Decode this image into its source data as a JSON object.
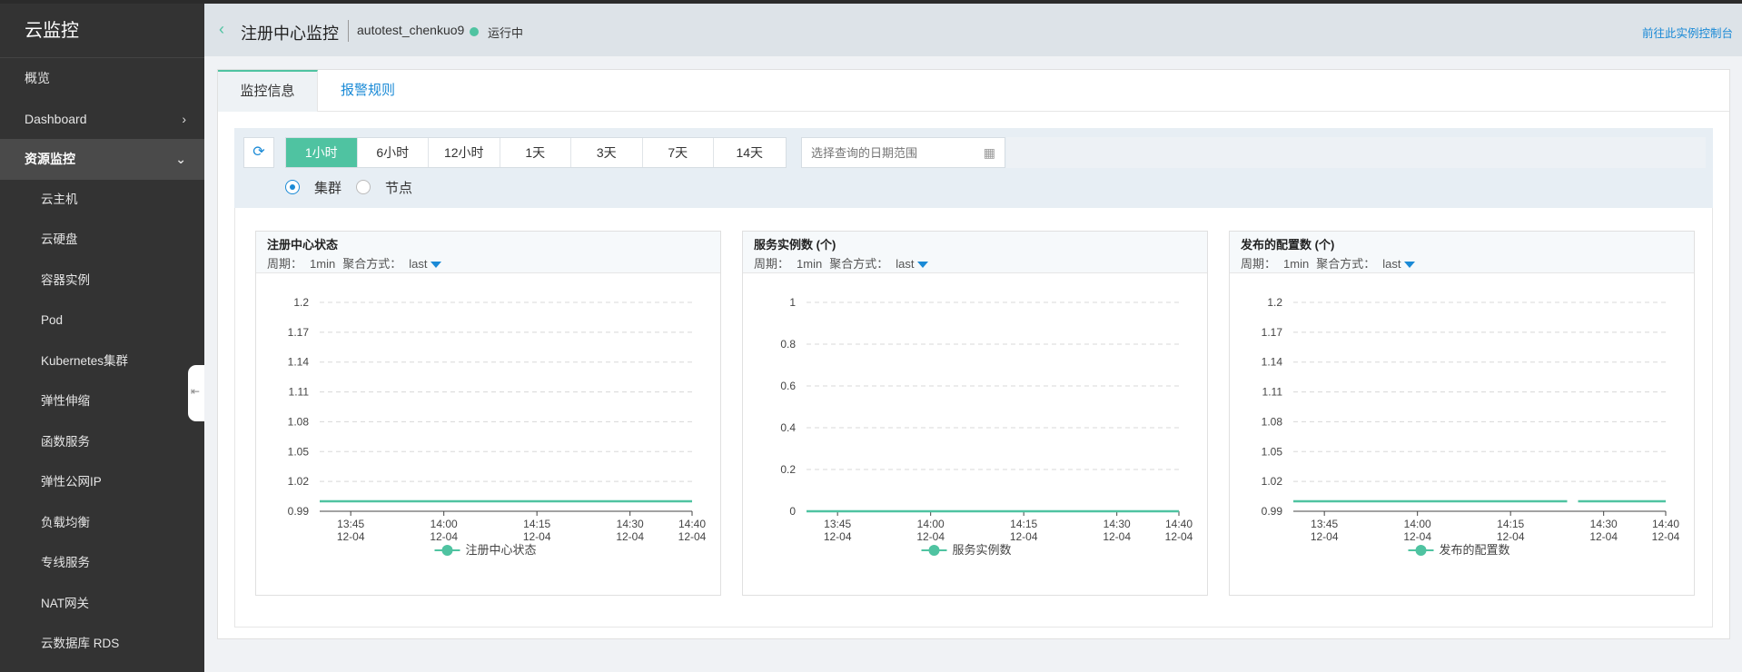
{
  "app": {
    "title": "云监控"
  },
  "sidebar": {
    "items": [
      {
        "label": "概览",
        "kind": "top"
      },
      {
        "label": "Dashboard",
        "kind": "top",
        "arrow": "›"
      },
      {
        "label": "资源监控",
        "kind": "group",
        "arrow": "⌄"
      },
      {
        "label": "云主机",
        "kind": "sub"
      },
      {
        "label": "云硬盘",
        "kind": "sub"
      },
      {
        "label": "容器实例",
        "kind": "sub"
      },
      {
        "label": "Pod",
        "kind": "sub"
      },
      {
        "label": "Kubernetes集群",
        "kind": "sub"
      },
      {
        "label": "弹性伸缩",
        "kind": "sub"
      },
      {
        "label": "函数服务",
        "kind": "sub"
      },
      {
        "label": "弹性公网IP",
        "kind": "sub"
      },
      {
        "label": "负载均衡",
        "kind": "sub"
      },
      {
        "label": "专线服务",
        "kind": "sub"
      },
      {
        "label": "NAT网关",
        "kind": "sub"
      },
      {
        "label": "云数据库 RDS",
        "kind": "sub"
      }
    ]
  },
  "header": {
    "title": "注册中心监控",
    "instance": "autotest_chenkuo9",
    "status": "运行中",
    "go_console": "前往此实例控制台"
  },
  "tabs": [
    "监控信息",
    "报警规则"
  ],
  "filter": {
    "ranges": [
      "1小时",
      "6小时",
      "12小时",
      "1天",
      "3天",
      "7天",
      "14天"
    ],
    "active_range": 0,
    "date_placeholder": "选择查询的日期范围",
    "radio_options": [
      "集群",
      "节点"
    ],
    "radio_selected": 0
  },
  "colors": {
    "accent": "#4fc3a1",
    "link": "#1a8ad6",
    "sidebar_bg": "#333333"
  },
  "charts_meta": {
    "period_label": "周期：",
    "period_value": "1min",
    "agg_label": "聚合方式：",
    "agg_value": "last"
  },
  "chart_data": [
    {
      "type": "line",
      "title": "注册中心状态",
      "x": [
        "13:45\n12-04",
        "14:00\n12-04",
        "14:15\n12-04",
        "14:30\n12-04",
        "14:40\n12-04"
      ],
      "yticks": [
        "0.99",
        "1.02",
        "1.05",
        "1.08",
        "1.11",
        "1.14",
        "1.17",
        "1.2"
      ],
      "ylim": [
        0.99,
        1.2
      ],
      "series": [
        {
          "name": "注册中心状态",
          "values": [
            1,
            1,
            1,
            1,
            1
          ]
        }
      ],
      "legend": "bottom-center",
      "grid": true
    },
    {
      "type": "line",
      "title": "服务实例数 (个)",
      "x": [
        "13:45\n12-04",
        "14:00\n12-04",
        "14:15\n12-04",
        "14:30\n12-04",
        "14:40\n12-04"
      ],
      "yticks": [
        "0",
        "0.2",
        "0.4",
        "0.6",
        "0.8",
        "1"
      ],
      "ylim": [
        0,
        1
      ],
      "series": [
        {
          "name": "服务实例数",
          "values": [
            0,
            0,
            0,
            0,
            0
          ]
        }
      ],
      "legend": "bottom-center",
      "grid": true
    },
    {
      "type": "line",
      "title": "发布的配置数 (个)",
      "x": [
        "13:45\n12-04",
        "14:00\n12-04",
        "14:15\n12-04",
        "14:30\n12-04",
        "14:40\n12-04"
      ],
      "yticks": [
        "0.99",
        "1.02",
        "1.05",
        "1.08",
        "1.11",
        "1.14",
        "1.17",
        "1.2"
      ],
      "ylim": [
        0.99,
        1.2
      ],
      "series": [
        {
          "name": "发布的配置数",
          "values": [
            1,
            1,
            1,
            1,
            1
          ],
          "gap_after_index": 2
        }
      ],
      "legend": "bottom-center",
      "grid": true
    }
  ]
}
